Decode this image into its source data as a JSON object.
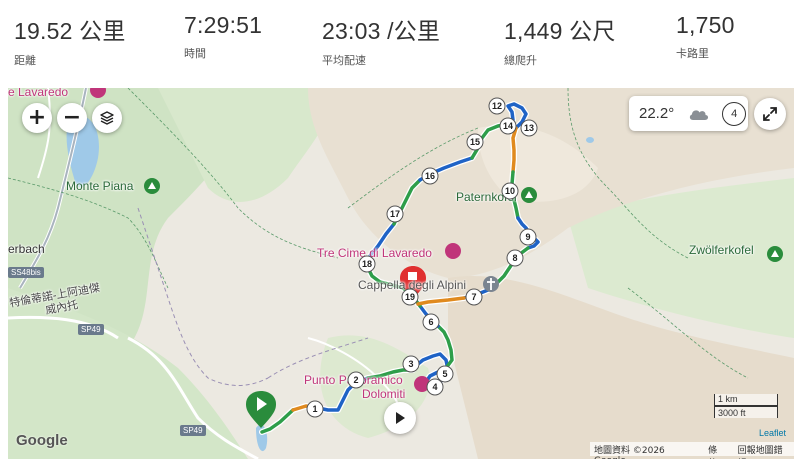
{
  "stats": [
    {
      "value": "19.52 公里",
      "label": "距離"
    },
    {
      "value": "7:29:51",
      "label": "時間"
    },
    {
      "value": "23:03 /公里",
      "label": "平均配速"
    },
    {
      "value": "1,449 公尺",
      "label": "總爬升"
    },
    {
      "value": "1,750",
      "label": "卡路里"
    }
  ],
  "map_controls": {
    "zoom_in": "+",
    "zoom_out": "−",
    "layers_icon": "layers-icon",
    "expand_icon": "expand-icon",
    "play_icon": "play-icon"
  },
  "weather": {
    "temperature": "22.2°",
    "wind_level": "4",
    "icon": "cloud-icon"
  },
  "places": {
    "lavaredo_top": "e Lavaredo",
    "monte_piana": "Monte Piana",
    "erbach": "erbach",
    "paternkofel": "Paternkofel",
    "tre_cime": "Tre Cime di Lavaredo",
    "zwolferkofel": "Zwölferkofel",
    "cappella": "Cappella degli Alpini",
    "punto_1": "Punto Panoramico",
    "punto_2": "Dolomiti",
    "trail_label_1": "特倫蒂諾-上阿迪傑",
    "trail_label_2": "威內托"
  },
  "roads": [
    "SS48bis",
    "SP49",
    "SP49"
  ],
  "waypoints": [
    "1",
    "2",
    "3",
    "4",
    "5",
    "6",
    "7",
    "8",
    "9",
    "10",
    "12",
    "13",
    "14",
    "15",
    "16",
    "17",
    "18",
    "19"
  ],
  "scale": {
    "metric": "1 km",
    "imperial": "3000 ft"
  },
  "attribution": {
    "leaflet": "Leaflet",
    "map_data": "地圖資料 ©2026 Google",
    "terms": "條款",
    "report": "回報地圖錯誤",
    "google": "Google"
  },
  "colors": {
    "route_green": "#2e9e4a",
    "route_blue": "#1f63c6",
    "route_orange": "#e08a1e",
    "start_green": "#2a8c3c",
    "end_red": "#e03030"
  }
}
